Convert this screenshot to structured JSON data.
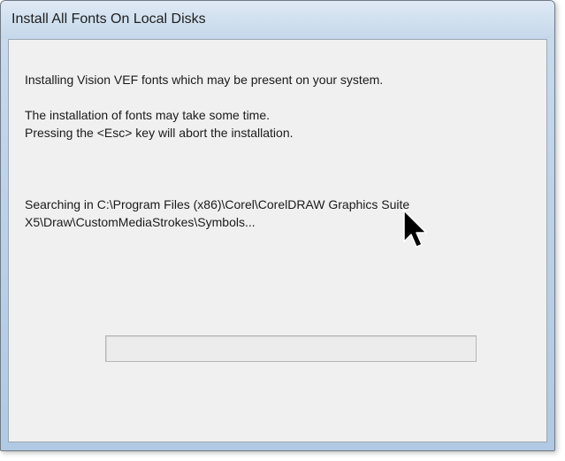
{
  "window": {
    "title": "Install All Fonts On Local Disks"
  },
  "messages": {
    "installing": "Installing Vision VEF fonts which may be present on your system.",
    "time_note": "The installation of fonts may take some time.",
    "abort_note": "Pressing the <Esc> key will abort the installation.",
    "searching": "Searching in C:\\Program Files (x86)\\Corel\\CorelDRAW Graphics Suite X5\\Draw\\CustomMediaStrokes\\Symbols..."
  },
  "progress": {
    "value": 0
  },
  "icons": {
    "cursor": "mouse-pointer-icon"
  }
}
